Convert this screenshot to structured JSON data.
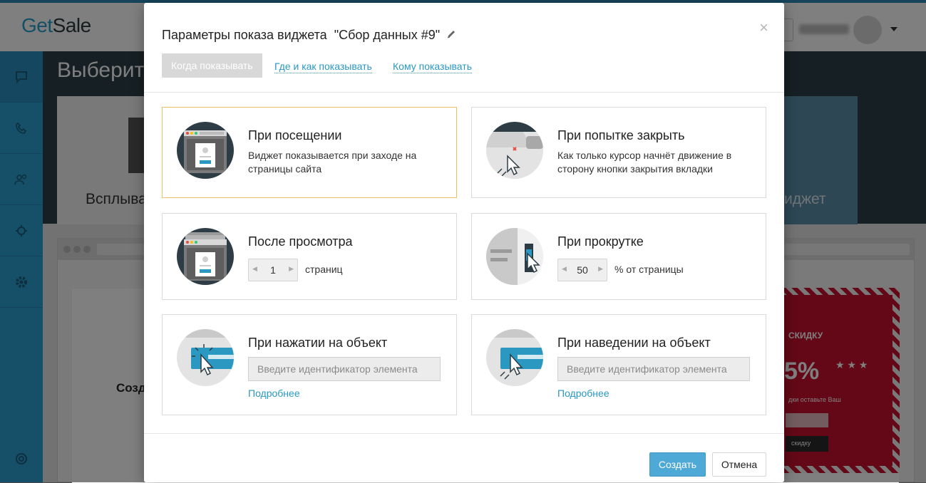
{
  "app": {
    "logo_part1": "Get",
    "logo_part2": "Sale",
    "page_title_partial": "Выберит",
    "card_label_left": "Всплыва",
    "card_label_right": "иджет",
    "create_partial": "Созд",
    "promo": {
      "line1": "СКИДКУ",
      "line2": "5%",
      "stars": "★ ★ ★",
      "line3": "дки оставьте Ваш",
      "button": "скидку"
    }
  },
  "modal": {
    "title": "Параметры показа виджета",
    "widget_name": "\"Сбор данных #9\"",
    "close_symbol": "×",
    "tabs": [
      {
        "label": "Когда показывать"
      },
      {
        "label": "Где и как показывать"
      },
      {
        "label": "Кому показывать"
      }
    ],
    "options": {
      "on_visit": {
        "title": "При посещении",
        "description": "Виджет показывается при заходе на страницы сайта"
      },
      "on_close_attempt": {
        "title": "При попытке закрыть",
        "description": "Как только курсор начнёт движение в сторону кнопки закрытия вкладки"
      },
      "after_views": {
        "title": "После просмотра",
        "value": "1",
        "suffix": "страниц"
      },
      "on_scroll": {
        "title": "При прокрутке",
        "value": "50",
        "suffix": "% от страницы"
      },
      "on_click": {
        "title": "При нажатии на объект",
        "placeholder": "Введите идентификатор элемента",
        "more": "Подробнее"
      },
      "on_hover": {
        "title": "При наведении на объект",
        "placeholder": "Введите идентификатор элемента",
        "more": "Подробнее"
      }
    },
    "buttons": {
      "create": "Создать",
      "cancel": "Отмена"
    }
  },
  "colors": {
    "accent": "#2a98c0",
    "selected_border": "#e9c25f",
    "sidebar": "#2a9fd0",
    "primary_button": "#4fa9d6"
  }
}
